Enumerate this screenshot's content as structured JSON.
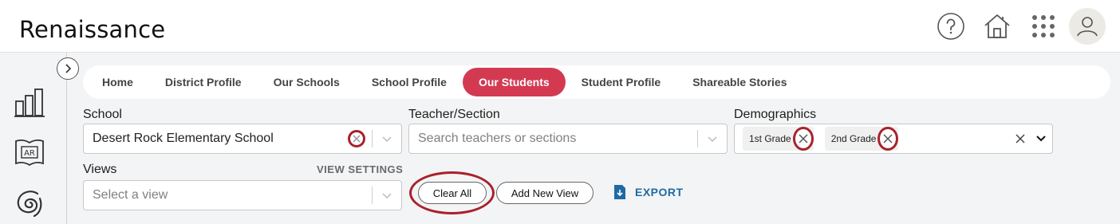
{
  "app": {
    "brand": "Renaissance"
  },
  "header_icons": [
    "help-icon",
    "home-icon",
    "apps-grid-icon",
    "user-avatar-icon"
  ],
  "nav": {
    "tabs": [
      {
        "label": "Home"
      },
      {
        "label": "District Profile"
      },
      {
        "label": "Our Schools"
      },
      {
        "label": "School Profile"
      },
      {
        "label": "Our Students",
        "active": true
      },
      {
        "label": "Student Profile"
      },
      {
        "label": "Shareable Stories"
      }
    ]
  },
  "filters": {
    "school": {
      "label": "School",
      "value": "Desert Rock Elementary School"
    },
    "teacher": {
      "label": "Teacher/Section",
      "placeholder": "Search teachers or sections"
    },
    "demographics": {
      "label": "Demographics",
      "chips": [
        "1st Grade",
        "2nd Grade"
      ]
    },
    "views": {
      "label": "Views",
      "placeholder": "Select a view",
      "settings_label": "VIEW SETTINGS"
    }
  },
  "actions": {
    "clear_all": "Clear All",
    "add_new_view": "Add New View",
    "export": "EXPORT"
  },
  "colors": {
    "accent": "#d33a52",
    "highlight_ring": "#a8222c",
    "link": "#1f6aa5"
  }
}
